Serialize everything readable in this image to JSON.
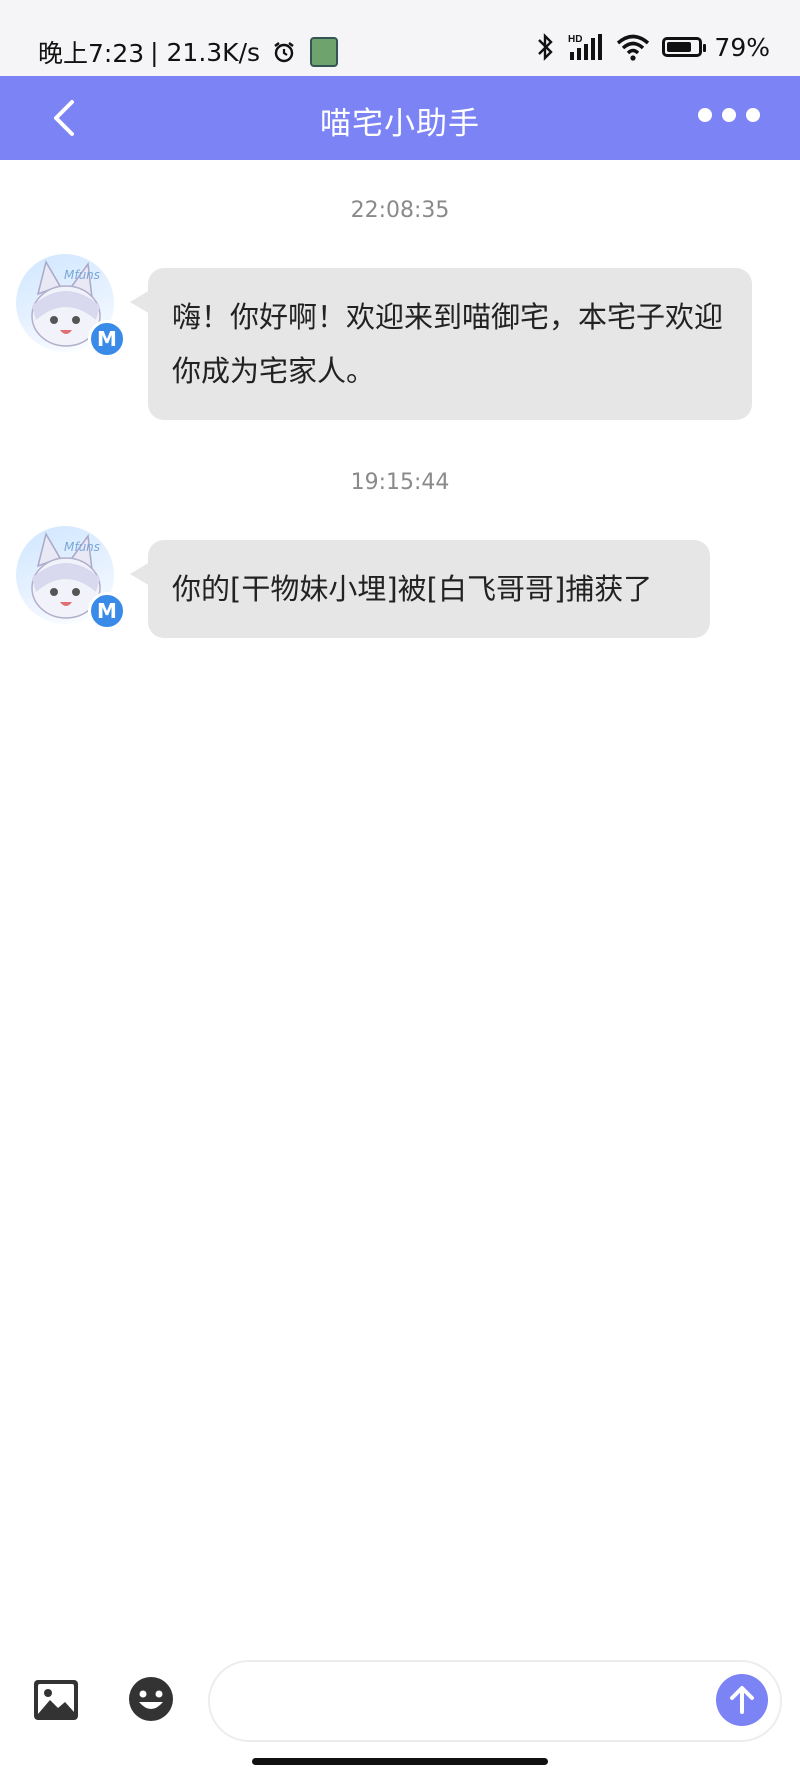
{
  "status_bar": {
    "time": "晚上7:23",
    "net_speed": "| 21.3K/s",
    "network_label": "HD",
    "battery_text": "79%",
    "battery_level": 0.79
  },
  "header": {
    "title": "喵宅小助手"
  },
  "messages": [
    {
      "timestamp": "22:08:35",
      "avatar_text": "Mfuns",
      "badge": "M",
      "text": "嗨！你好啊！欢迎来到喵御宅，本宅子欢迎你成为宅家人。"
    },
    {
      "timestamp": "19:15:44",
      "avatar_text": "Mfuns",
      "badge": "M",
      "text": "你的[干物妹小埋]被[白飞哥哥]捕获了"
    }
  ],
  "composer": {
    "value": "",
    "placeholder": ""
  },
  "icons": {
    "back": "chevron-left-icon",
    "more": "more-dots-icon",
    "image": "image-icon",
    "emoji": "emoji-icon",
    "send": "send-arrow-up-icon"
  },
  "colors": {
    "accent": "#7b83f5",
    "bubble": "#e6e6e6",
    "badge": "#3a8be8"
  }
}
